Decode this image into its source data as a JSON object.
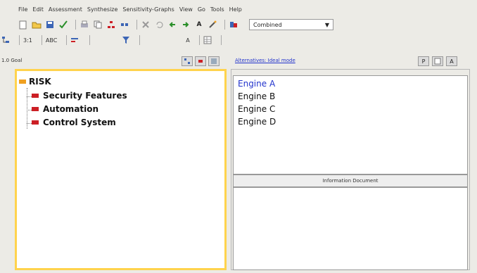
{
  "menu": [
    "File",
    "Edit",
    "Assessment",
    "Synthesize",
    "Sensitivity-Graphs",
    "View",
    "Go",
    "Tools",
    "Help"
  ],
  "toolbar1": {
    "icons": [
      "new-icon",
      "open-icon",
      "save-icon",
      "check-icon",
      "print-icon",
      "copy-icon",
      "insert-child-icon",
      "insert-sibling-icon",
      "delete-icon",
      "undo-icon",
      "go-left-icon",
      "go-right-icon",
      "font-icon",
      "wand-icon",
      "combine-icon"
    ],
    "combo_value": "Combined",
    "combo_arrow": "▼"
  },
  "toolbar2": {
    "items": [
      "3:1",
      "ABC",
      "",
      "",
      ""
    ]
  },
  "panel_bar": {
    "goal_label": "1.0 Goal",
    "alt_link": "Alternatives: Ideal mode",
    "right_tools": [
      "P",
      "",
      "A"
    ]
  },
  "tree": {
    "root": "RISK",
    "children": [
      "Security Features",
      "Automation",
      "Control System"
    ]
  },
  "alternatives": [
    "Engine A",
    "Engine B",
    "Engine C",
    "Engine D"
  ],
  "info_document": {
    "header": "Information Document"
  },
  "colors": {
    "tree_border": "#ffd34d",
    "node_marker": "#cc1f25",
    "goal_marker": "#f0a020",
    "selected_alt": "#2233cc"
  }
}
